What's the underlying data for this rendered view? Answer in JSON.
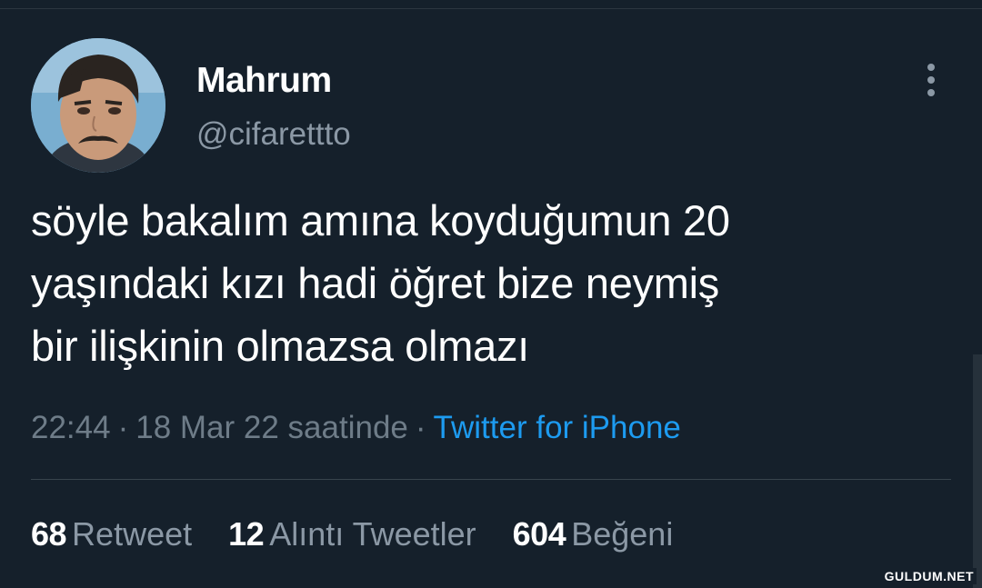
{
  "tweet": {
    "author": {
      "display_name": "Mahrum",
      "handle": "@cifarettto"
    },
    "text_lines": [
      "söyle bakalım amına koyduğumun 20",
      "yaşındaki kızı hadi öğret bize neymiş",
      "bir ilişkinin olmazsa olmazı"
    ],
    "time": "22:44",
    "date": "18 Mar 22 saatinde",
    "source": "Twitter for iPhone",
    "stats": {
      "retweets": {
        "count": "68",
        "label": "Retweet"
      },
      "quotes": {
        "count": "12",
        "label": "Alıntı Tweetler"
      },
      "likes": {
        "count": "604",
        "label": "Beğeni"
      }
    }
  },
  "icons": {
    "more": "more-options-icon"
  },
  "watermark": "GULDUM.NET",
  "colors": {
    "background": "#15202b",
    "link": "#1d9bf0",
    "secondary_text": "#8b98a5"
  }
}
